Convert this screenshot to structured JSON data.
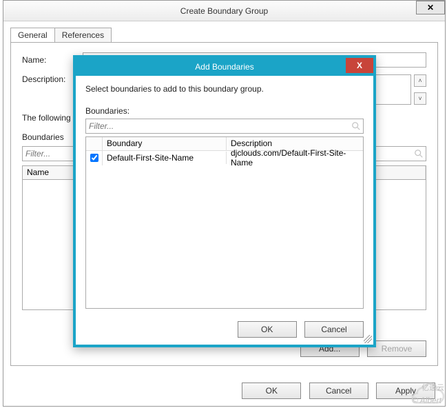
{
  "outer": {
    "title": "Create Boundary Group",
    "close_glyph": "✕",
    "tabs": {
      "general": "General",
      "references": "References"
    },
    "labels": {
      "name": "Name:",
      "description": "Description:",
      "following": "The following",
      "boundaries": "Boundaries"
    },
    "filter_placeholder": "Filter...",
    "table": {
      "col_name": "Name"
    },
    "buttons": {
      "add": "Add...",
      "remove": "Remove"
    },
    "footer": {
      "ok": "OK",
      "cancel": "Cancel",
      "apply": "Apply"
    }
  },
  "modal": {
    "title": "Add Boundaries",
    "close_glyph": "X",
    "instruction": "Select boundaries to add to this boundary group.",
    "label_boundaries": "Boundaries:",
    "filter_placeholder": "Filter...",
    "columns": {
      "boundary": "Boundary",
      "description": "Description"
    },
    "rows": [
      {
        "checked": true,
        "boundary": "Default-First-Site-Name",
        "description": "djclouds.com/Default-First-Site-Name"
      }
    ],
    "buttons": {
      "ok": "OK",
      "cancel": "Cancel"
    }
  },
  "watermark": "© Albert",
  "brand": "亿速云"
}
